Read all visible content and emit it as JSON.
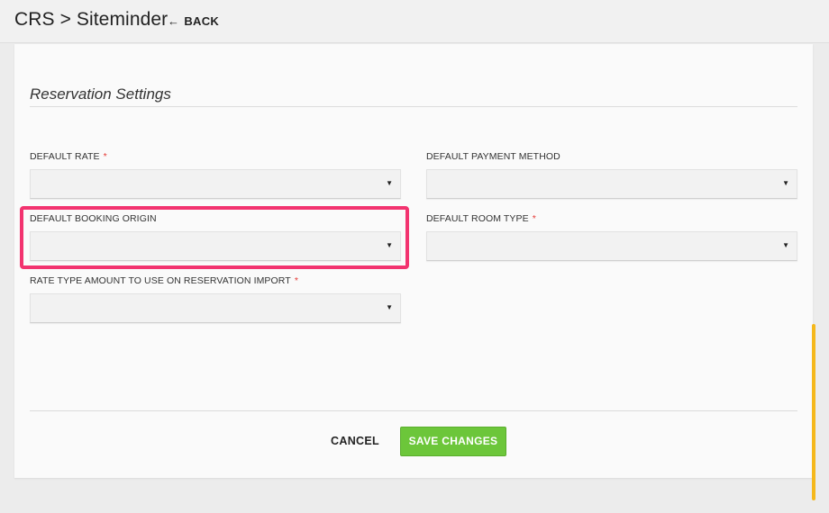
{
  "header": {
    "breadcrumb": "CRS > Siteminder",
    "back_label": "BACK",
    "back_icon": "left-arrow-icon"
  },
  "section": {
    "title": "Reservation Settings"
  },
  "fields": {
    "default_rate": {
      "label": "DEFAULT RATE",
      "required": "*",
      "value": ""
    },
    "default_payment_method": {
      "label": "DEFAULT PAYMENT METHOD",
      "value": ""
    },
    "default_booking_origin": {
      "label": "DEFAULT BOOKING ORIGIN",
      "value": ""
    },
    "default_room_type": {
      "label": "DEFAULT ROOM TYPE",
      "required": "*",
      "value": ""
    },
    "rate_type_amount": {
      "label": "RATE TYPE AMOUNT TO USE ON RESERVATION IMPORT",
      "required": "*",
      "value": ""
    }
  },
  "caret_glyph": "▼",
  "actions": {
    "cancel_label": "CANCEL",
    "save_label": "SAVE CHANGES"
  },
  "colors": {
    "highlight": "#f2336f",
    "save_button": "#6cc63a",
    "required_marker": "#e53935",
    "scrollbar": "#f5b81c"
  }
}
